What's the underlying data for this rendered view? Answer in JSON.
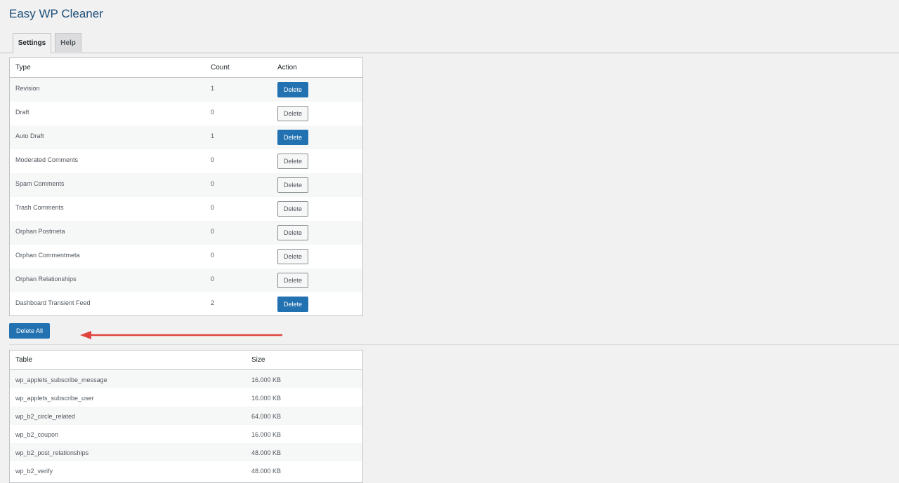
{
  "page": {
    "title": "Easy WP Cleaner"
  },
  "tabs": [
    {
      "label": "Settings",
      "active": true
    },
    {
      "label": "Help",
      "active": false
    }
  ],
  "clean_table": {
    "headers": {
      "type": "Type",
      "count": "Count",
      "action": "Action"
    },
    "rows": [
      {
        "type": "Revision",
        "count": "1",
        "action": "Delete",
        "enabled": true
      },
      {
        "type": "Draft",
        "count": "0",
        "action": "Delete",
        "enabled": false
      },
      {
        "type": "Auto Draft",
        "count": "1",
        "action": "Delete",
        "enabled": true
      },
      {
        "type": "Moderated Comments",
        "count": "0",
        "action": "Delete",
        "enabled": false
      },
      {
        "type": "Spam Comments",
        "count": "0",
        "action": "Delete",
        "enabled": false
      },
      {
        "type": "Trash Comments",
        "count": "0",
        "action": "Delete",
        "enabled": false
      },
      {
        "type": "Orphan Postmeta",
        "count": "0",
        "action": "Delete",
        "enabled": false
      },
      {
        "type": "Orphan Commentmeta",
        "count": "0",
        "action": "Delete",
        "enabled": false
      },
      {
        "type": "Orphan Relationships",
        "count": "0",
        "action": "Delete",
        "enabled": false
      },
      {
        "type": "Dashboard Transient Feed",
        "count": "2",
        "action": "Delete",
        "enabled": true
      }
    ]
  },
  "delete_all": {
    "label": "Delete All"
  },
  "annotation": {
    "arrow_color": "#e0443e"
  },
  "db_table": {
    "headers": {
      "table": "Table",
      "size": "Size"
    },
    "rows": [
      {
        "table": "wp_applets_subscribe_message",
        "size": "16.000 KB"
      },
      {
        "table": "wp_applets_subscribe_user",
        "size": "16.000 KB"
      },
      {
        "table": "wp_b2_circle_related",
        "size": "64.000 KB"
      },
      {
        "table": "wp_b2_coupon",
        "size": "16.000 KB"
      },
      {
        "table": "wp_b2_post_relationships",
        "size": "48.000 KB"
      },
      {
        "table": "wp_b2_verify",
        "size": "48.000 KB"
      }
    ]
  },
  "colors": {
    "primary": "#2271b1",
    "title": "#1d4f7a",
    "background": "#f1f1f1"
  }
}
